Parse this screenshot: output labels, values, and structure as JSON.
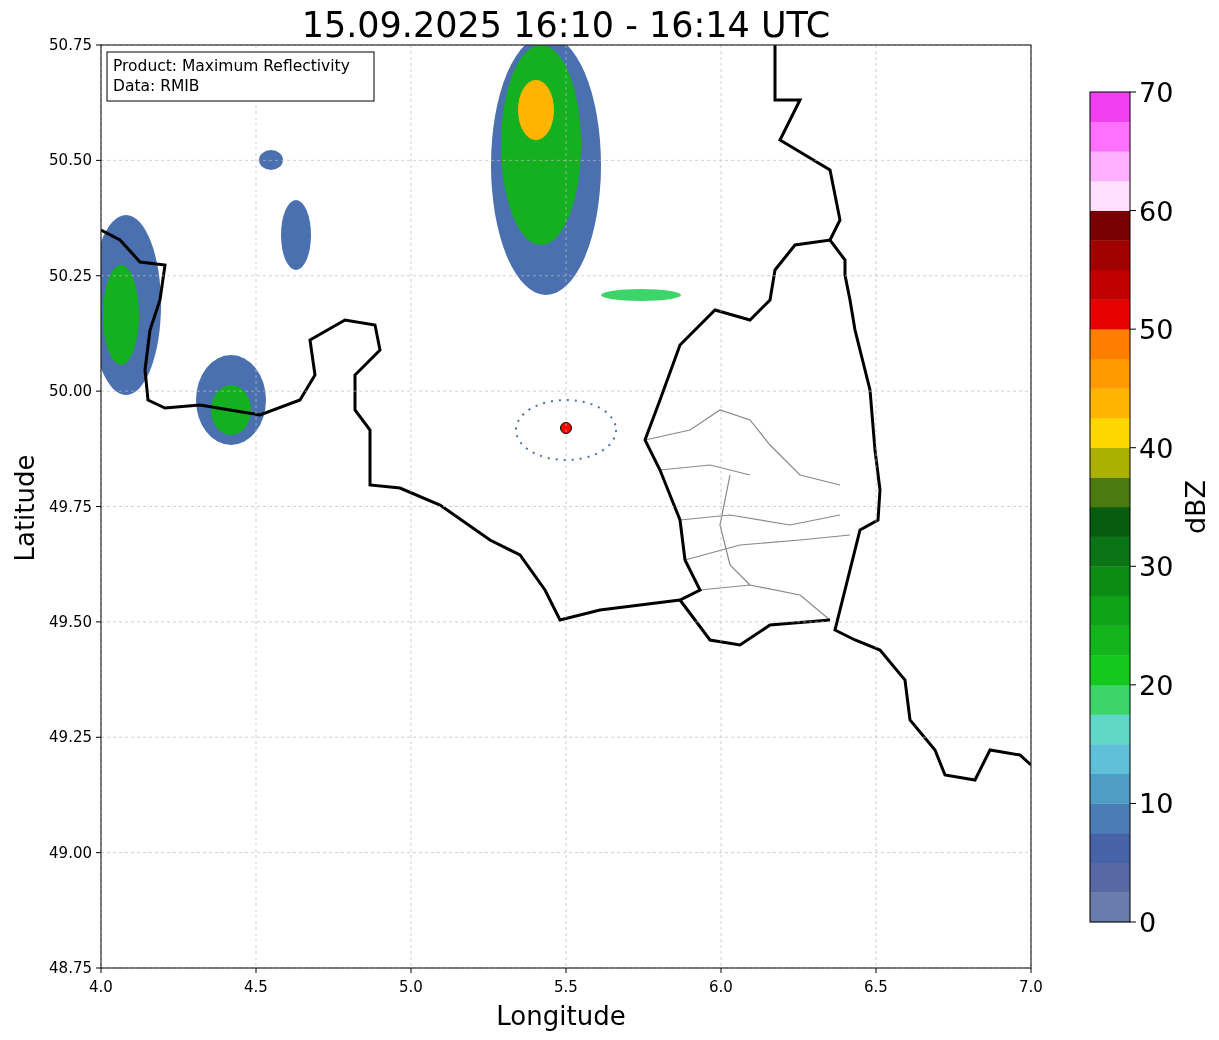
{
  "title": "15.09.2025 16:10 - 16:14 UTC",
  "legend": [
    "Product: Maximum Reflectivity",
    "Data: RMIB"
  ],
  "xlabel": "Longitude",
  "ylabel": "Latitude",
  "xticks": [
    "4.0",
    "4.5",
    "5.0",
    "5.5",
    "6.0",
    "6.5",
    "7.0"
  ],
  "yticks": [
    "50.75",
    "50.50",
    "50.25",
    "50.00",
    "49.75",
    "49.50",
    "49.25",
    "49.00",
    "48.75"
  ],
  "colorbar": {
    "label": "dBZ",
    "ticks": [
      "70",
      "60",
      "50",
      "40",
      "30",
      "20",
      "10",
      "0"
    ],
    "bands": [
      {
        "color": "#6a7cab"
      },
      {
        "color": "#5868a3"
      },
      {
        "color": "#4763a8"
      },
      {
        "color": "#4a7db5"
      },
      {
        "color": "#4f9cc4"
      },
      {
        "color": "#60c0d9"
      },
      {
        "color": "#60d8c8"
      },
      {
        "color": "#3dd46a"
      },
      {
        "color": "#14c81e"
      },
      {
        "color": "#12b51c"
      },
      {
        "color": "#0fa318"
      },
      {
        "color": "#0d8c14"
      },
      {
        "color": "#0b7414"
      },
      {
        "color": "#085c10"
      },
      {
        "color": "#4a7a10"
      },
      {
        "color": "#acb000"
      },
      {
        "color": "#ffd700"
      },
      {
        "color": "#ffb400"
      },
      {
        "color": "#ff9a00"
      },
      {
        "color": "#ff7f00"
      },
      {
        "color": "#e60000"
      },
      {
        "color": "#c00000"
      },
      {
        "color": "#a00000"
      },
      {
        "color": "#780000"
      },
      {
        "color": "#ffe0ff"
      },
      {
        "color": "#ffb0ff"
      },
      {
        "color": "#ff70ff"
      },
      {
        "color": "#f040f0"
      }
    ]
  }
}
